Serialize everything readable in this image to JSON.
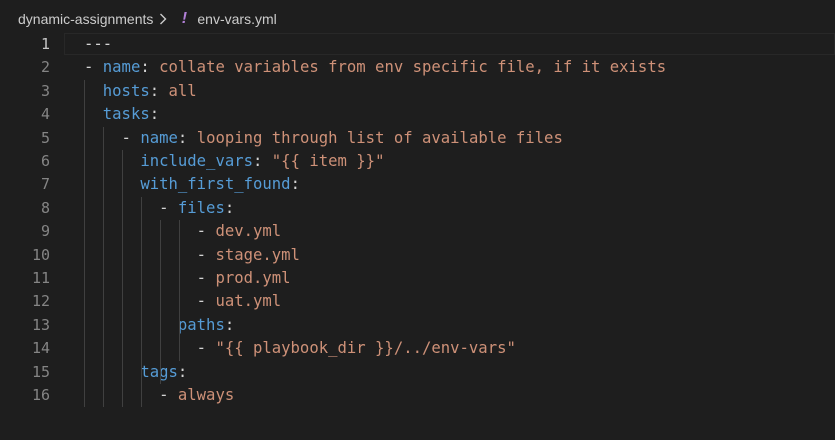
{
  "breadcrumb": {
    "folder": "dynamic-assignments",
    "separator": ">",
    "file_icon": "yaml-exclamation-icon",
    "file_icon_glyph": "!",
    "file": "env-vars.yml"
  },
  "editor": {
    "active_line": 1,
    "lines": [
      {
        "number": "1",
        "tokens": [
          {
            "text": "---",
            "type": "p"
          }
        ]
      },
      {
        "number": "2",
        "tokens": [
          {
            "text": "- ",
            "type": "p"
          },
          {
            "text": "name",
            "type": "k"
          },
          {
            "text": ": ",
            "type": "p"
          },
          {
            "text": "collate variables from env specific file, if it exists",
            "type": "s"
          }
        ]
      },
      {
        "number": "3",
        "tokens": [
          {
            "text": "  ",
            "type": "p"
          },
          {
            "text": "hosts",
            "type": "k"
          },
          {
            "text": ": ",
            "type": "p"
          },
          {
            "text": "all",
            "type": "s"
          }
        ]
      },
      {
        "number": "4",
        "tokens": [
          {
            "text": "  ",
            "type": "p"
          },
          {
            "text": "tasks",
            "type": "k"
          },
          {
            "text": ":",
            "type": "p"
          }
        ]
      },
      {
        "number": "5",
        "tokens": [
          {
            "text": "    - ",
            "type": "p"
          },
          {
            "text": "name",
            "type": "k"
          },
          {
            "text": ": ",
            "type": "p"
          },
          {
            "text": "looping through list of available files",
            "type": "s"
          }
        ]
      },
      {
        "number": "6",
        "tokens": [
          {
            "text": "      ",
            "type": "p"
          },
          {
            "text": "include_vars",
            "type": "k"
          },
          {
            "text": ": ",
            "type": "p"
          },
          {
            "text": "\"{{ item }}\"",
            "type": "s"
          }
        ]
      },
      {
        "number": "7",
        "tokens": [
          {
            "text": "      ",
            "type": "p"
          },
          {
            "text": "with_first_found",
            "type": "k"
          },
          {
            "text": ":",
            "type": "p"
          }
        ]
      },
      {
        "number": "8",
        "tokens": [
          {
            "text": "        - ",
            "type": "p"
          },
          {
            "text": "files",
            "type": "k"
          },
          {
            "text": ":",
            "type": "p"
          }
        ]
      },
      {
        "number": "9",
        "tokens": [
          {
            "text": "            - ",
            "type": "p"
          },
          {
            "text": "dev.yml",
            "type": "s"
          }
        ]
      },
      {
        "number": "10",
        "tokens": [
          {
            "text": "            - ",
            "type": "p"
          },
          {
            "text": "stage.yml",
            "type": "s"
          }
        ]
      },
      {
        "number": "11",
        "tokens": [
          {
            "text": "            - ",
            "type": "p"
          },
          {
            "text": "prod.yml",
            "type": "s"
          }
        ]
      },
      {
        "number": "12",
        "tokens": [
          {
            "text": "            - ",
            "type": "p"
          },
          {
            "text": "uat.yml",
            "type": "s"
          }
        ]
      },
      {
        "number": "13",
        "tokens": [
          {
            "text": "          ",
            "type": "p"
          },
          {
            "text": "paths",
            "type": "k"
          },
          {
            "text": ":",
            "type": "p"
          }
        ]
      },
      {
        "number": "14",
        "tokens": [
          {
            "text": "            - ",
            "type": "p"
          },
          {
            "text": "\"{{ playbook_dir }}/../env-vars\"",
            "type": "s"
          }
        ]
      },
      {
        "number": "15",
        "tokens": [
          {
            "text": "      ",
            "type": "p"
          },
          {
            "text": "tags",
            "type": "k"
          },
          {
            "text": ":",
            "type": "p"
          }
        ]
      },
      {
        "number": "16",
        "tokens": [
          {
            "text": "        - ",
            "type": "p"
          },
          {
            "text": "always",
            "type": "s"
          }
        ]
      }
    ]
  },
  "colors": {
    "background": "#1e1e1e",
    "keyword": "#569cd6",
    "string": "#ce9178",
    "punctuation": "#d4d4d4",
    "line_number": "#858585",
    "active_line_number": "#c6c6c6",
    "yaml_icon": "#b180d7"
  }
}
